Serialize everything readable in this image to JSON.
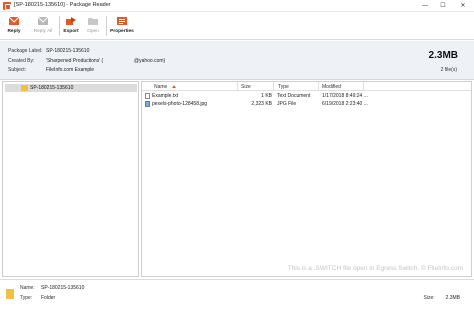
{
  "window": {
    "title": "[SP-180215-135610] - Package Reader",
    "controls": [
      "—",
      "☐",
      "✕"
    ]
  },
  "toolbar": {
    "buttons": [
      {
        "label": "Reply",
        "icon": "reply-icon",
        "enabled": true
      },
      {
        "label": "Reply All",
        "icon": "reply-all-icon",
        "enabled": false
      },
      {
        "label": "Export",
        "icon": "export-icon",
        "enabled": true
      },
      {
        "label": "Open",
        "icon": "open-icon",
        "enabled": false
      },
      {
        "label": "Properties",
        "icon": "properties-icon",
        "enabled": true
      }
    ]
  },
  "package": {
    "label_key": "Package Label:",
    "label_value": "SP-180215-135610",
    "created_key": "Created By:",
    "created_value": "'Sharpened Productions' (",
    "created_email": "@yahoo.com)",
    "subject_key": "Subject:",
    "subject_value": "FileInfo.com Example",
    "size": "2.3MB",
    "files_count": "2 file(s)"
  },
  "tree": {
    "items": [
      {
        "label": "SP-180215-135610",
        "icon": "folder-icon",
        "selected": true
      }
    ]
  },
  "file_list": {
    "columns": [
      "Name",
      "Size",
      "Type",
      "Modified"
    ],
    "sorted_column": "Name",
    "rows": [
      {
        "name": "Example.txt",
        "size": "1 KB",
        "type": "Text Document",
        "modified": "1/17/2018 8:49:24 ...",
        "icon": "text-file-icon"
      },
      {
        "name": "pexels-photo-128458.jpg",
        "size": "2,323 KB",
        "type": "JPG File",
        "modified": "6/19/2018 2:23:40 ...",
        "icon": "image-file-icon"
      }
    ],
    "watermark": "This is a .SWITCH file open in Egress Switch. © FileInfo.com"
  },
  "status": {
    "name_key": "Name:",
    "name_value": "SP-180215-135610",
    "type_key": "Type:",
    "type_value": "Folder",
    "size_key": "Size:",
    "size_value": "2.3MB"
  },
  "colors": {
    "accent": "#e05a2b",
    "folder": "#f1c040",
    "info_bg": "#eef1f5",
    "selection": "#dcdcdc"
  }
}
